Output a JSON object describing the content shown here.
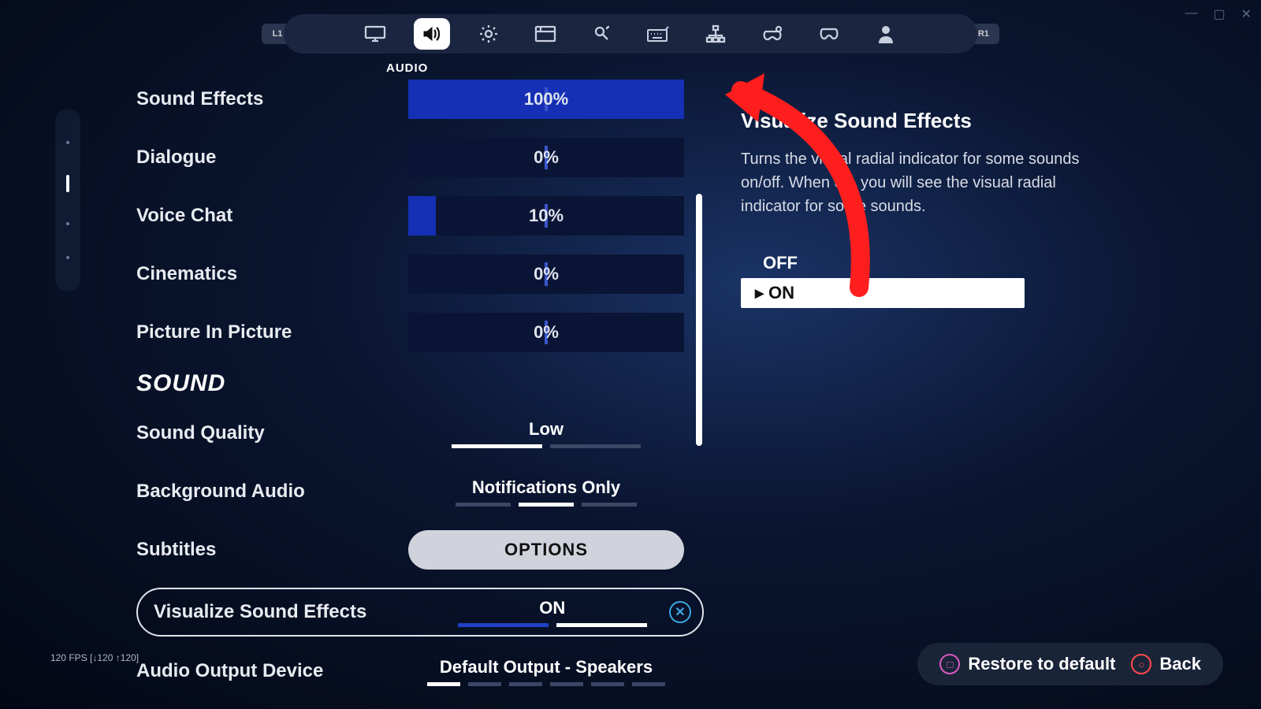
{
  "bumpers": {
    "left": "L1",
    "right": "R1"
  },
  "tab_label": "AUDIO",
  "sliders": [
    {
      "label": "Sound Effects",
      "value": "100%",
      "fill": 100
    },
    {
      "label": "Dialogue",
      "value": "0%",
      "fill": 0
    },
    {
      "label": "Voice Chat",
      "value": "10%",
      "fill": 10
    },
    {
      "label": "Cinematics",
      "value": "0%",
      "fill": 0
    },
    {
      "label": "Picture In Picture",
      "value": "0%",
      "fill": 0
    }
  ],
  "section": "SOUND",
  "quality": {
    "label": "Sound Quality",
    "value": "Low"
  },
  "bgaudio": {
    "label": "Background Audio",
    "value": "Notifications Only"
  },
  "subtitles": {
    "label": "Subtitles",
    "button": "OPTIONS"
  },
  "visualize": {
    "label": "Visualize Sound Effects",
    "value": "ON"
  },
  "output": {
    "label": "Audio Output Device",
    "value": "Default Output - Speakers"
  },
  "desc": {
    "title": "Visualize Sound Effects",
    "body": "Turns the visual radial indicator for some sounds on/off. When on, you will see the visual radial indicator for some sounds.",
    "off": "OFF",
    "on": "ON"
  },
  "footer": {
    "restore": "Restore to default",
    "back": "Back"
  },
  "fps": "120 FPS [↓120 ↑120]"
}
